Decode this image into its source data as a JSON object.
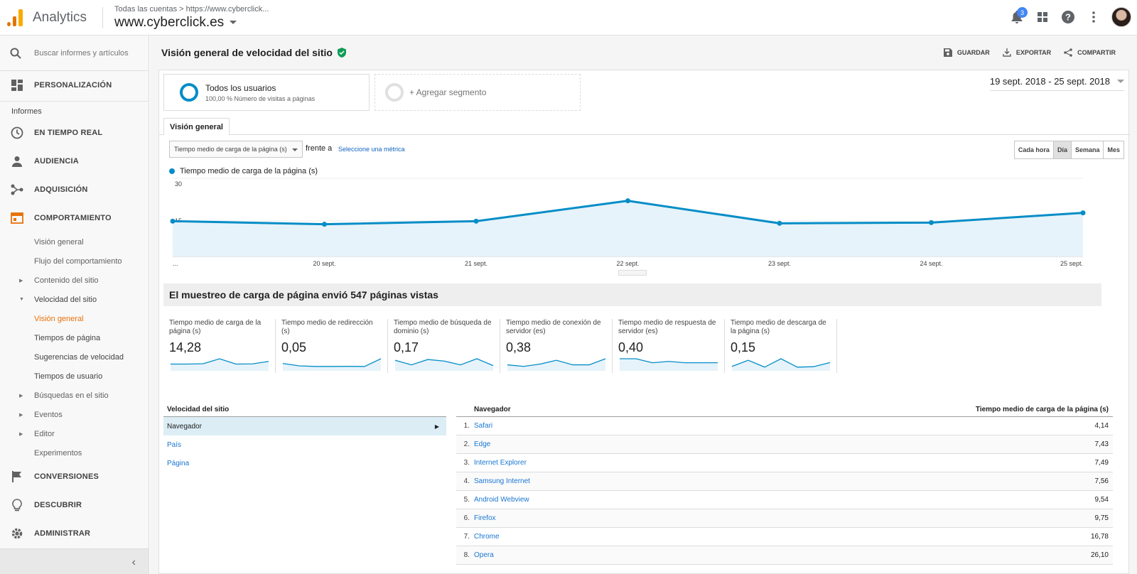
{
  "app": {
    "name": "Analytics",
    "breadcrumb": [
      "Todas las cuentas",
      "https://www.cyberclick..."
    ],
    "property": "www.cyberclick.es",
    "notifications_count": "3"
  },
  "sidebar": {
    "search_placeholder": "Buscar informes y artículos",
    "personalizacion": "PERSONALIZACIÓN",
    "informes_label": "Informes",
    "sections": {
      "tiempo_real": "EN TIEMPO REAL",
      "audiencia": "AUDIENCIA",
      "adquisicion": "ADQUISICIÓN",
      "comportamiento": "COMPORTAMIENTO",
      "conversiones": "CONVERSIONES",
      "descubrir": "DESCUBRIR",
      "administrar": "ADMINISTRAR"
    },
    "comportamiento_items": {
      "vision_general": "Visión general",
      "flujo": "Flujo del comportamiento",
      "contenido": "Contenido del sitio",
      "velocidad": "Velocidad del sitio",
      "vel_vision": "Visión general",
      "tiempos_pagina": "Tiempos de página",
      "sugerencias": "Sugerencias de velocidad",
      "tiempos_usuario": "Tiempos de usuario",
      "busquedas": "Búsquedas en el sitio",
      "eventos": "Eventos",
      "editor": "Editor",
      "experimentos": "Experimentos"
    }
  },
  "report": {
    "title": "Visión general de velocidad del sitio",
    "actions": {
      "save": "GUARDAR",
      "export": "EXPORTAR",
      "share": "COMPARTIR"
    },
    "segment": {
      "title": "Todos los usuarios",
      "subtitle": "100,00 % Número de visitas a páginas"
    },
    "add_segment": "+ Agregar segmento",
    "date_range": "19 sept. 2018 - 25 sept. 2018",
    "tab": "Visión general",
    "metric_select": "Tiempo medio de carga de la página (s)",
    "vs_label": "frente a",
    "pick_metric": "Seleccione una métrica",
    "granularity": [
      "Cada hora",
      "Día",
      "Semana",
      "Mes"
    ],
    "granularity_selected": "Día",
    "summary": "El muestreo de carga de página envió 547 páginas vistas"
  },
  "chart_data": {
    "type": "area",
    "series": [
      {
        "name": "Tiempo medio de carga de la página (s)",
        "values": [
          14.9,
          13.6,
          14.9,
          23.5,
          14.0,
          14.3,
          18.4
        ]
      }
    ],
    "x": [
      "...",
      "20 sept.",
      "21 sept.",
      "22 sept.",
      "23 sept.",
      "24 sept.",
      "25 sept."
    ],
    "yticks": [
      "30",
      "15"
    ],
    "ylim": [
      0,
      30
    ],
    "color": "#058dc7"
  },
  "kpis": [
    {
      "label": "Tiempo medio de carga de la página (s)",
      "value": "14,28",
      "spark": [
        3,
        3,
        3.2,
        6,
        3,
        3.1,
        4.5
      ]
    },
    {
      "label": "Tiempo medio de redirección (s)",
      "value": "0,05",
      "spark": [
        5,
        3,
        2.5,
        2.5,
        2.6,
        2.5,
        9
      ]
    },
    {
      "label": "Tiempo medio de búsqueda de dominio (s)",
      "value": "0,17",
      "spark": [
        6,
        3,
        6.5,
        5.5,
        3,
        7,
        2.5
      ]
    },
    {
      "label": "Tiempo medio de conexión de servidor (es)",
      "value": "0,38",
      "spark": [
        3,
        2,
        3.5,
        6,
        3,
        3,
        7
      ]
    },
    {
      "label": "Tiempo medio de respuesta de servidor (es)",
      "value": "0,40",
      "spark": [
        8,
        8,
        5,
        6,
        5,
        5,
        5
      ]
    },
    {
      "label": "Tiempo medio de descarga de la página (s)",
      "value": "0,15",
      "spark": [
        2,
        6,
        1.5,
        7,
        1.5,
        1.8,
        4.5
      ]
    }
  ],
  "left_table": {
    "header": "Velocidad del sitio",
    "rows": [
      "Navegador",
      "País",
      "Página"
    ]
  },
  "right_table": {
    "col1": "Navegador",
    "col2": "Tiempo medio de carga de la página (s)",
    "rows": [
      {
        "n": "1.",
        "name": "Safari",
        "value": "4,14"
      },
      {
        "n": "2.",
        "name": "Edge",
        "value": "7,43"
      },
      {
        "n": "3.",
        "name": "Internet Explorer",
        "value": "7,49"
      },
      {
        "n": "4.",
        "name": "Samsung Internet",
        "value": "7,56"
      },
      {
        "n": "5.",
        "name": "Android Webview",
        "value": "9,54"
      },
      {
        "n": "6.",
        "name": "Firefox",
        "value": "9,75"
      },
      {
        "n": "7.",
        "name": "Chrome",
        "value": "16,78"
      },
      {
        "n": "8.",
        "name": "Opera",
        "value": "26,10"
      }
    ]
  }
}
